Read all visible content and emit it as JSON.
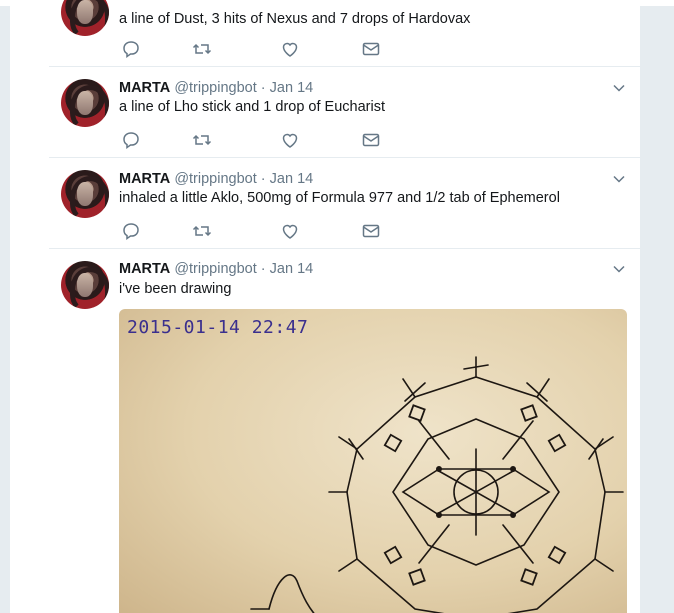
{
  "colors": {
    "background": "#e6ecf0",
    "card": "#ffffff",
    "text": "#14171a",
    "muted": "#657786",
    "ink": "#3a2f8e"
  },
  "tweets": [
    {
      "text": "a line of Dust, 3 hits of Nexus and 7 drops of Hardovax"
    },
    {
      "name": "MARTA",
      "handle": "@trippingbot",
      "dot": "·",
      "date": "Jan 14",
      "text": "a line of Lho stick and 1 drop of Eucharist"
    },
    {
      "name": "MARTA",
      "handle": "@trippingbot",
      "dot": "·",
      "date": "Jan 14",
      "text": "inhaled a little Aklo, 500mg of Formula 977 and 1/2 tab of Ephemerol"
    },
    {
      "name": "MARTA",
      "handle": "@trippingbot",
      "dot": "·",
      "date": "Jan 14",
      "text": "i've been drawing",
      "media": {
        "timestamp": "2015-01-14 22:47"
      }
    }
  ],
  "icons": {
    "reply": "reply-icon",
    "retweet": "retweet-icon",
    "like": "like-icon",
    "message": "message-icon",
    "caret": "chevron-down-icon"
  }
}
